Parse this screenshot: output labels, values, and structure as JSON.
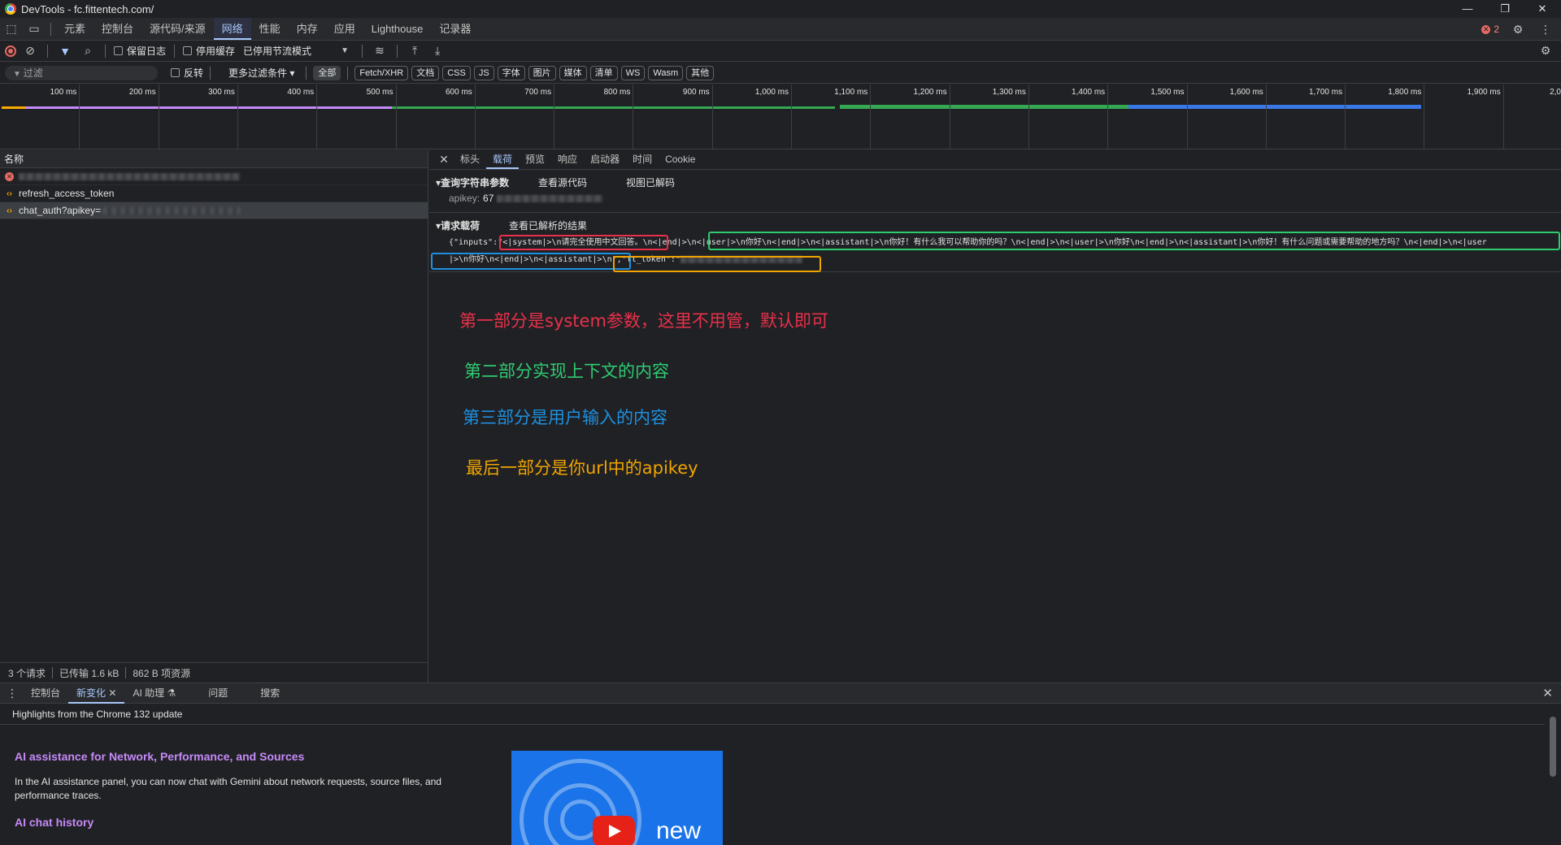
{
  "window": {
    "title": "DevTools - fc.fittentech.com/",
    "controls": [
      "—",
      "❐",
      "✕"
    ]
  },
  "panel_tabs": [
    "元素",
    "控制台",
    "源代码/来源",
    "网络",
    "性能",
    "内存",
    "应用",
    "Lighthouse",
    "记录器"
  ],
  "active_panel": "网络",
  "error_count": "2",
  "toolbar": {
    "preserve_log": "保留日志",
    "disable_cache": "停用缓存",
    "throttling": "已停用节流模式"
  },
  "filterbar": {
    "placeholder": "过滤",
    "invert": "反转",
    "more_filters": "更多过滤条件",
    "types": [
      "全部",
      "Fetch/XHR",
      "文档",
      "CSS",
      "JS",
      "字体",
      "图片",
      "媒体",
      "清单",
      "WS",
      "Wasm",
      "其他"
    ]
  },
  "timeline": {
    "ticks": [
      "100 ms",
      "200 ms",
      "300 ms",
      "400 ms",
      "500 ms",
      "600 ms",
      "700 ms",
      "800 ms",
      "900 ms",
      "1,000 ms",
      "1,100 ms",
      "1,200 ms",
      "1,300 ms",
      "1,400 ms",
      "1,500 ms",
      "1,600 ms",
      "1,700 ms",
      "1,800 ms",
      "1,900 ms",
      "2,0"
    ]
  },
  "request_list": {
    "column_name": "名称",
    "rows": [
      {
        "name": "",
        "type": "error"
      },
      {
        "name": "refresh_access_token",
        "type": "xhr"
      },
      {
        "name": "chat_auth?apikey=",
        "type": "xhr",
        "selected": true
      }
    ],
    "status": {
      "requests": "3 个请求",
      "transferred": "已传输 1.6 kB",
      "resources": "862 B 项资源"
    }
  },
  "detail": {
    "tabs": [
      "标头",
      "载荷",
      "预览",
      "响应",
      "启动器",
      "时间",
      "Cookie"
    ],
    "active_tab": "载荷",
    "query_section": {
      "title": "▾查询字符串参数",
      "view_source": "查看源代码",
      "view_decoded": "视图已解码",
      "param_key": "apikey:",
      "param_value_prefix": "67"
    },
    "payload_section": {
      "title": "▾请求载荷",
      "view_parsed": "查看已解析的结果",
      "line1": "{\"inputs\":\"<|system|>\\n请完全使用中文回答。\\n<|end|>\\n<|user|>\\n你好\\n<|end|>\\n<|assistant|>\\n你好！有什么我可以帮助你的吗？\\n<|end|>\\n<|user|>\\n你好\\n<|end|>\\n<|assistant|>\\n你好！有什么问题或需要帮助的地方吗？\\n<|end|>\\n<|user",
      "line2": "|>\\n你好\\n<|end|>\\n<|assistant|>\\n\",\"ft_token\":\""
    }
  },
  "annotations": [
    {
      "text": "第一部分是system参数，这里不用管，默认即可",
      "color": "#e8304a"
    },
    {
      "text": "第二部分实现上下文的内容",
      "color": "#2ecc71"
    },
    {
      "text": "第三部分是用户输入的内容",
      "color": "#1e90e0"
    },
    {
      "text": "最后一部分是你url中的apikey",
      "color": "#f0a500"
    }
  ],
  "drawer": {
    "tabs": [
      "控制台",
      "新变化",
      "AI 助理",
      "问题",
      "搜索"
    ],
    "active_tab": "新变化",
    "header": "Highlights from the Chrome 132 update",
    "heading1": "AI assistance for Network, Performance, and Sources",
    "paragraph1": "In the AI assistance panel, you can now chat with Gemini about network requests, source files, and performance traces.",
    "heading2": "AI chat history",
    "video_label": "new"
  }
}
